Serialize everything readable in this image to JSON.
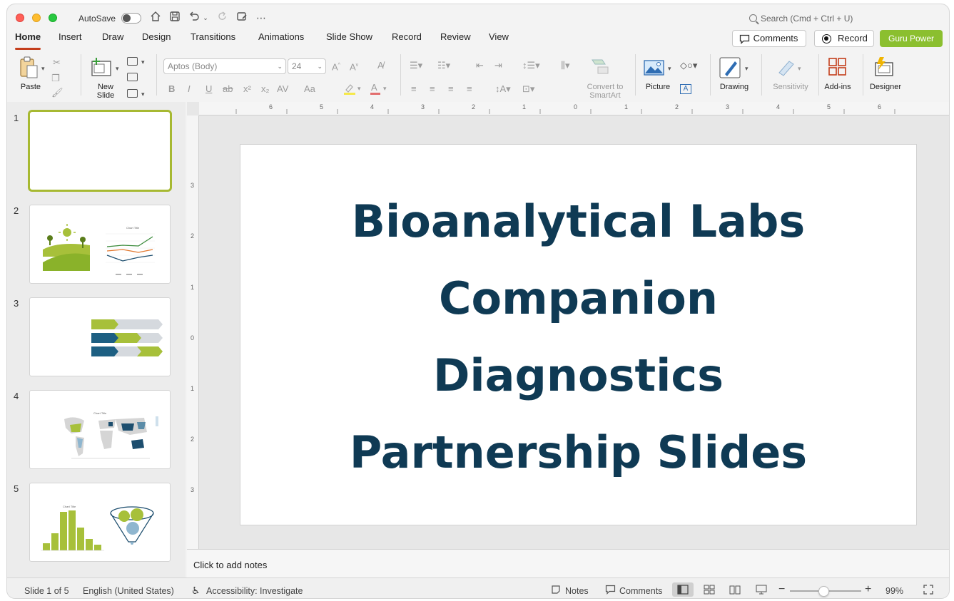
{
  "titlebar": {
    "autosave_label": "AutoSave",
    "search_placeholder": "Search (Cmd + Ctrl + U)"
  },
  "tabs": [
    {
      "label": "Home",
      "active": true
    },
    {
      "label": "Insert"
    },
    {
      "label": "Draw"
    },
    {
      "label": "Design"
    },
    {
      "label": "Transitions"
    },
    {
      "label": "Animations"
    },
    {
      "label": "Slide Show"
    },
    {
      "label": "Record"
    },
    {
      "label": "Review"
    },
    {
      "label": "View"
    }
  ],
  "actions": {
    "comments": "Comments",
    "record": "Record",
    "guru": "Guru Power"
  },
  "ribbon": {
    "paste": "Paste",
    "new_slide_1": "New",
    "new_slide_2": "Slide",
    "font_name": "Aptos (Body)",
    "font_size": "24",
    "convert_smartart_1": "Convert to",
    "convert_smartart_2": "SmartArt",
    "picture": "Picture",
    "drawing": "Drawing",
    "sensitivity": "Sensitivity",
    "addins": "Add-ins",
    "designer": "Designer"
  },
  "ruler": {
    "h_ticks": [
      "6",
      "5",
      "4",
      "3",
      "2",
      "1",
      "0",
      "1",
      "2",
      "3",
      "4",
      "5",
      "6"
    ],
    "v_ticks": [
      "3",
      "2",
      "1",
      "0",
      "1",
      "2",
      "3"
    ]
  },
  "thumbnails": [
    {
      "num": "1"
    },
    {
      "num": "2",
      "chart_title": "Chart Title"
    },
    {
      "num": "3"
    },
    {
      "num": "4",
      "chart_title": "Chart Title"
    },
    {
      "num": "5",
      "chart_title": "Chart Title"
    }
  ],
  "slide": {
    "title_lines": [
      "Bioanalytical Labs",
      "Companion",
      "Diagnostics",
      "Partnership Slides"
    ],
    "title_color": "#0f3a54"
  },
  "notes": {
    "placeholder": "Click to add notes"
  },
  "status": {
    "slide_of": "Slide 1 of 5",
    "language": "English (United States)",
    "accessibility": "Accessibility: Investigate",
    "notes": "Notes",
    "comments": "Comments",
    "zoom": "99%"
  },
  "colors": {
    "accent_tab": "#c43e1c",
    "guru_green": "#8bbf2f",
    "theme_green": "#a7c03a",
    "theme_navy": "#1d4e6e"
  }
}
